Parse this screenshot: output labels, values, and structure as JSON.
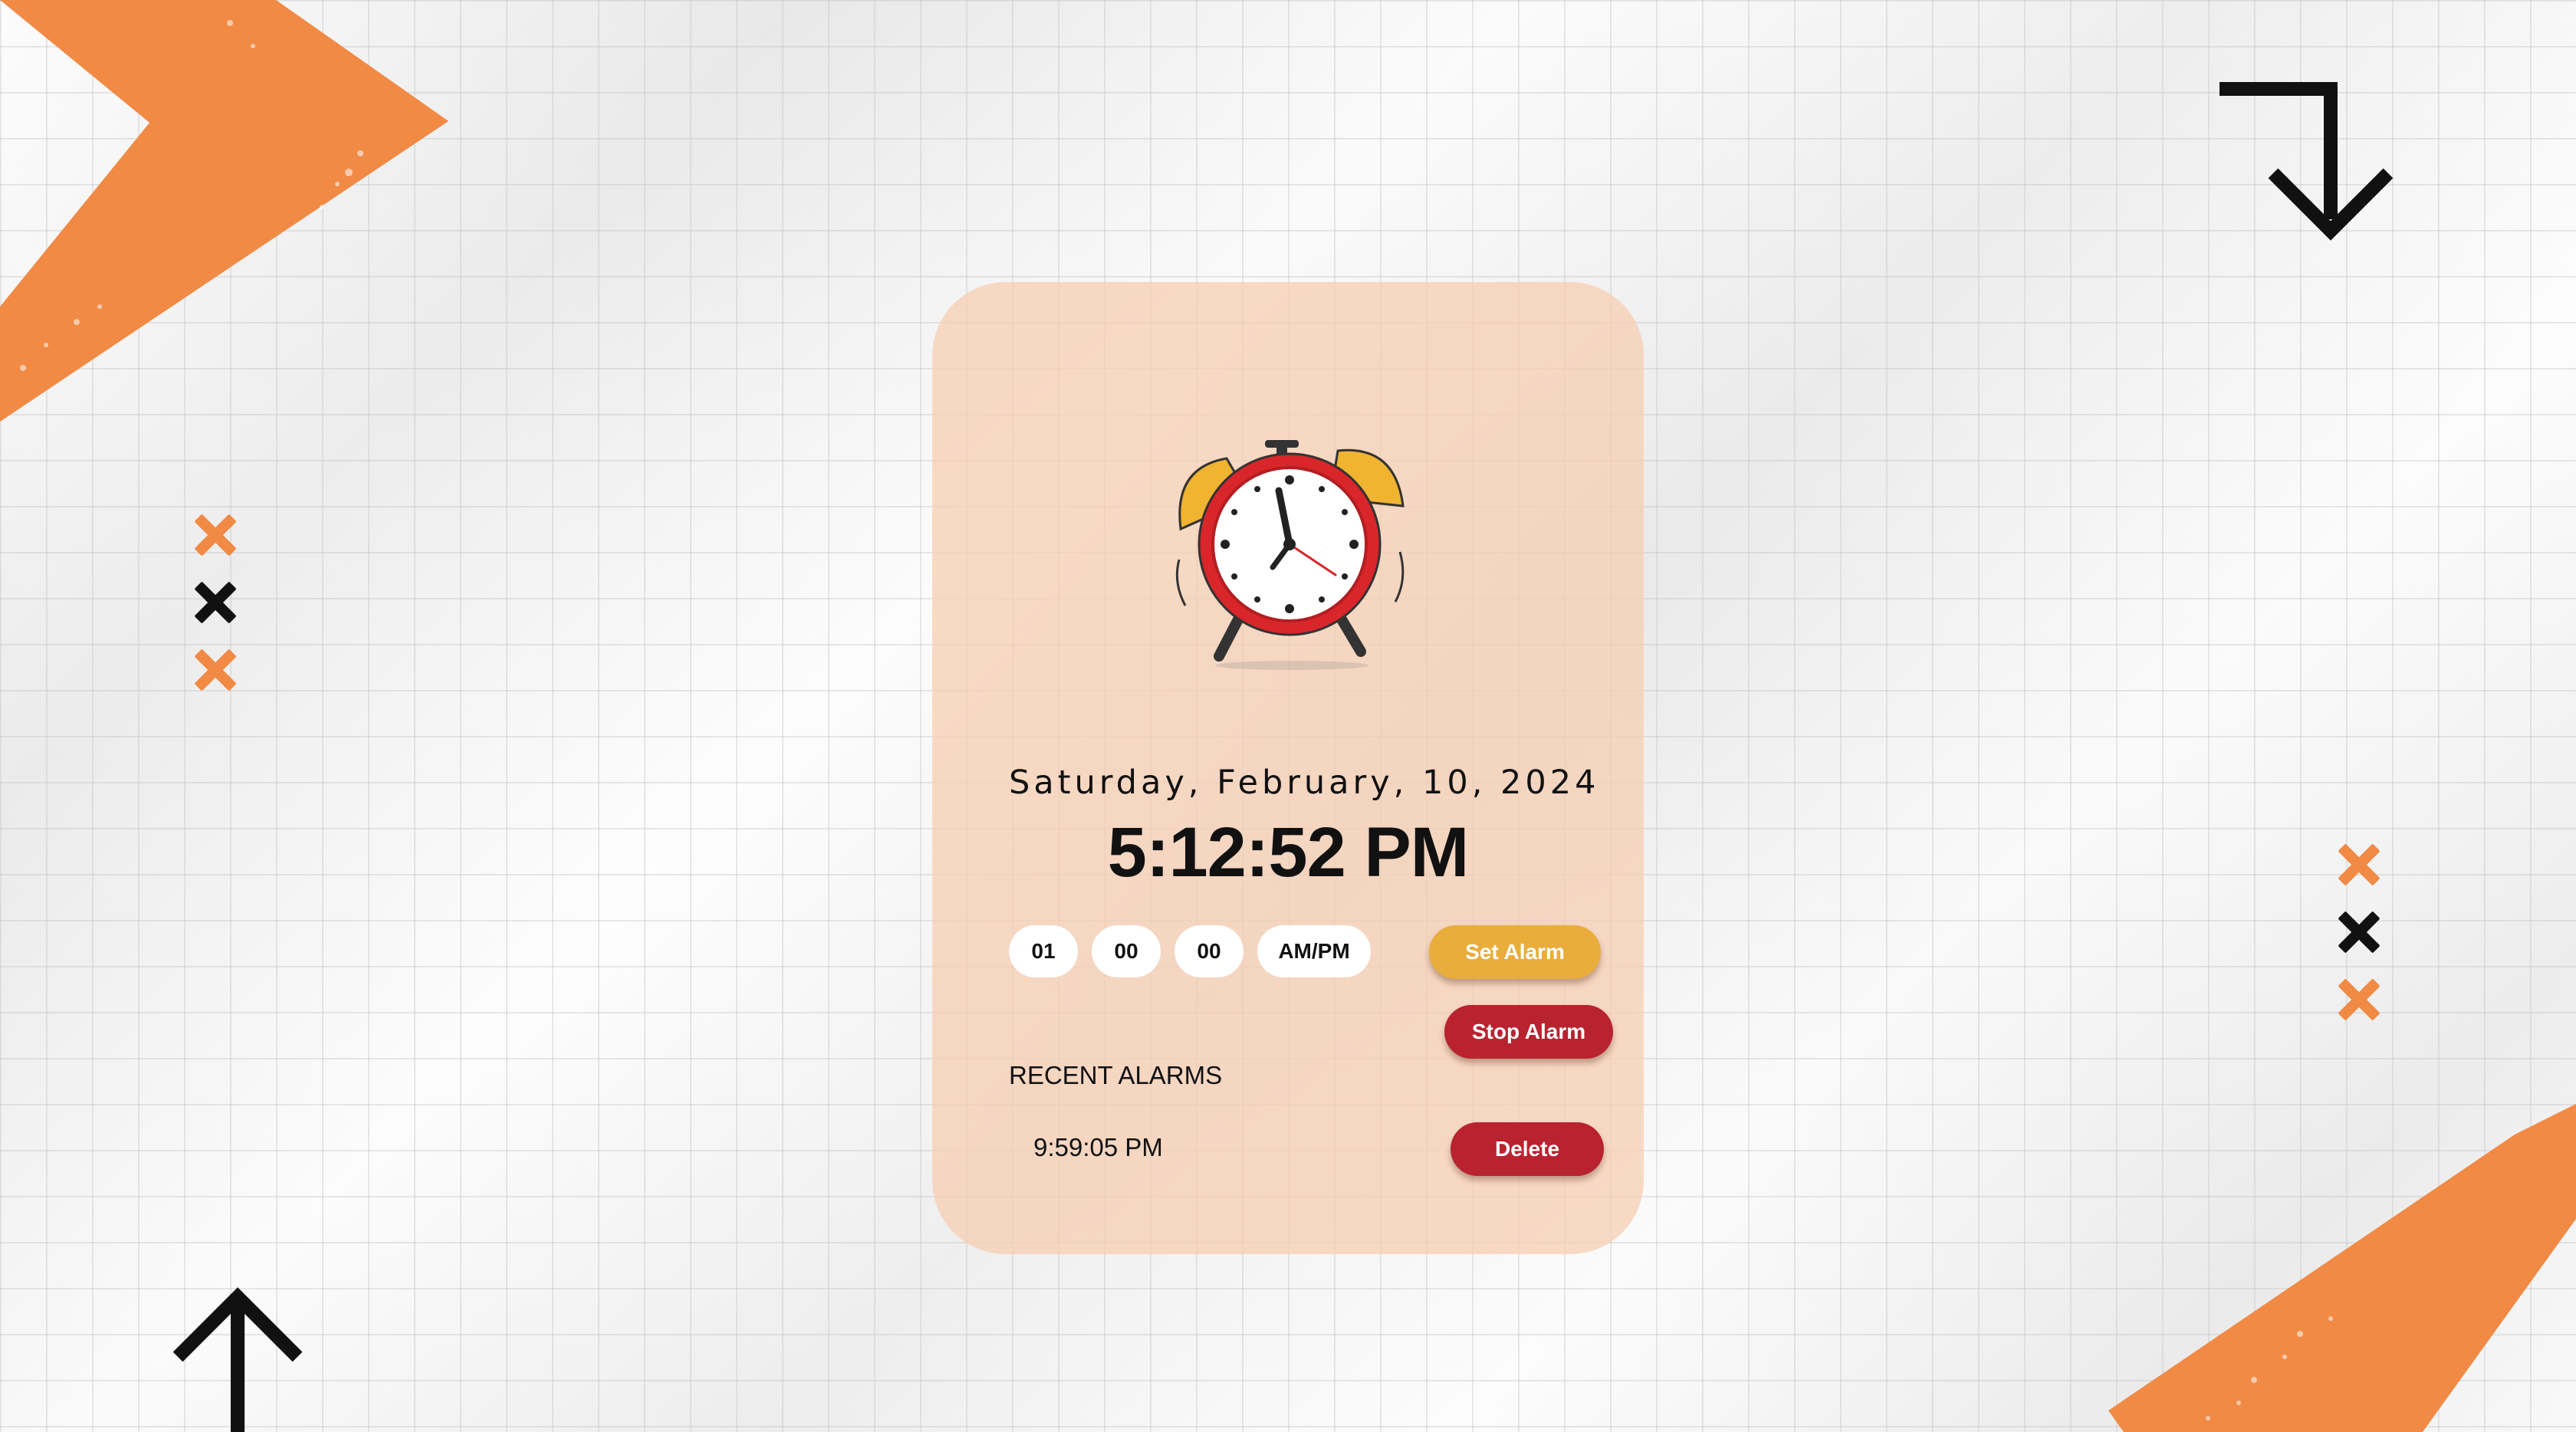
{
  "colors": {
    "accent_orange": "#f08a45",
    "card_background": "#f7cdb2",
    "set_button": "#e9ad3c",
    "stop_button": "#b8232f",
    "delete_button": "#b8232f",
    "decor_black": "#111111"
  },
  "icons": {
    "clock": "alarm-clock-icon",
    "arrow_down_right": "turn-down-arrow-icon",
    "arrow_up": "up-arrow-icon",
    "x_mark": "x-mark-icon"
  },
  "clock": {
    "date": "Saturday, February, 10, 2024",
    "time": "5:12:52 PM"
  },
  "alarm_form": {
    "hour": "01",
    "minute": "00",
    "second": "00",
    "ampm": "AM/PM",
    "set_label": "Set Alarm",
    "stop_label": "Stop Alarm"
  },
  "recent": {
    "title": "RECENT ALARMS",
    "items": [
      {
        "time": "9:59:05 PM",
        "delete_label": "Delete"
      }
    ]
  }
}
